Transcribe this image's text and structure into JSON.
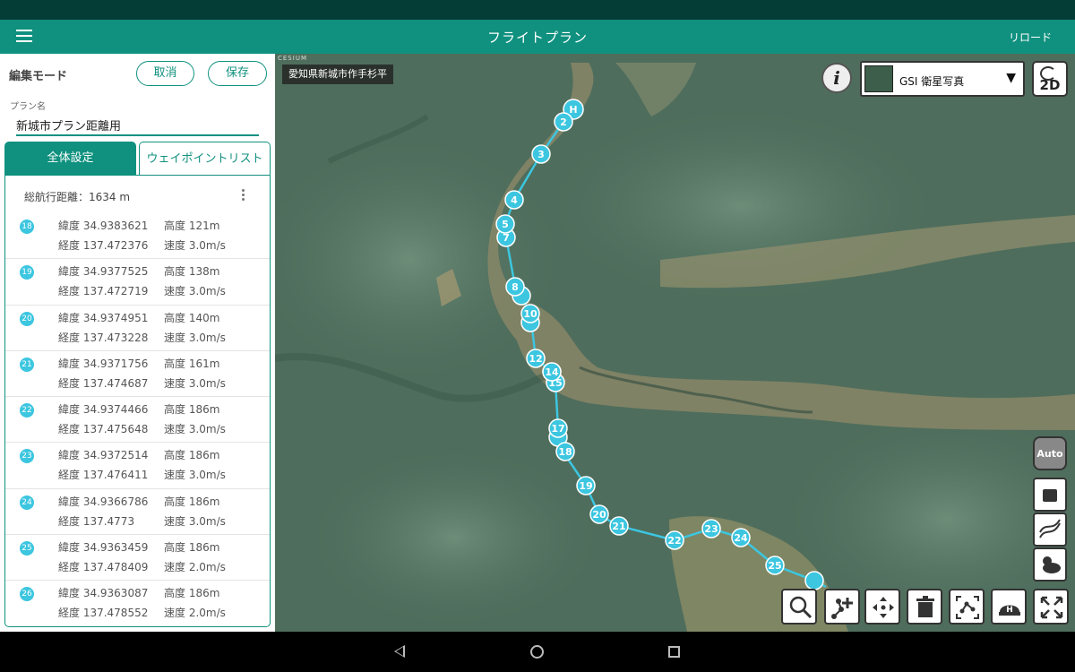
{
  "app_bar": {
    "title": "フライトプラン",
    "reload_label": "リロード"
  },
  "editor": {
    "mode_label": "編集モード",
    "cancel_label": "取消",
    "save_label": "保存",
    "plan_name_label": "プラン名",
    "plan_name_value": "新城市プラン距離用"
  },
  "tabs": {
    "global_label": "全体設定",
    "waypoints_label": "ウェイポイントリスト"
  },
  "waypoints": {
    "total_distance": "総航行距離：1634 m",
    "items": [
      {
        "num": "18",
        "lat": "緯度 34.9383621",
        "lon": "経度 137.472376",
        "alt": "高度 121m",
        "speed": "速度 3.0m/s"
      },
      {
        "num": "19",
        "lat": "緯度 34.9377525",
        "lon": "経度 137.472719",
        "alt": "高度 138m",
        "speed": "速度 3.0m/s"
      },
      {
        "num": "20",
        "lat": "緯度 34.9374951",
        "lon": "経度 137.473228",
        "alt": "高度 140m",
        "speed": "速度 3.0m/s"
      },
      {
        "num": "21",
        "lat": "緯度 34.9371756",
        "lon": "経度 137.474687",
        "alt": "高度 161m",
        "speed": "速度 3.0m/s"
      },
      {
        "num": "22",
        "lat": "緯度 34.9374466",
        "lon": "経度 137.475648",
        "alt": "高度 186m",
        "speed": "速度 3.0m/s"
      },
      {
        "num": "23",
        "lat": "緯度 34.9372514",
        "lon": "経度 137.476411",
        "alt": "高度 186m",
        "speed": "速度 3.0m/s"
      },
      {
        "num": "24",
        "lat": "緯度 34.9366786",
        "lon": "経度 137.4773",
        "alt": "高度 186m",
        "speed": "速度 3.0m/s"
      },
      {
        "num": "25",
        "lat": "緯度 34.9363459",
        "lon": "経度 137.478409",
        "alt": "高度 186m",
        "speed": "速度 2.0m/s"
      },
      {
        "num": "26",
        "lat": "緯度 34.9363087",
        "lon": "経度 137.478552",
        "alt": "高度 186m",
        "speed": "速度 2.0m/s"
      }
    ]
  },
  "map": {
    "attribution": "CESIUM",
    "location_label": "愛知県新城市作手杉平",
    "info_label": "i",
    "layer_select_value": "GSI 衛星写真",
    "layer_caret": "▼",
    "view_mode_label": "2D",
    "auto_label": "Auto",
    "home_marker_label": "H",
    "route_markers": [
      "2",
      "3",
      "4",
      "5",
      "7",
      "8",
      "10",
      "12",
      "13",
      "14",
      "15",
      "17",
      "18",
      "19",
      "20",
      "21",
      "22",
      "23",
      "24",
      "25"
    ],
    "route_color": "#3cc6e0",
    "icons": [
      "zoom-icon",
      "add-waypoint-icon",
      "move-icon",
      "trash-icon",
      "route-icon",
      "home-point-icon",
      "expand-icon",
      "camera-icon",
      "flight-path-icon",
      "weather-icon"
    ]
  },
  "colors": {
    "accent": "#10917f",
    "status_bar": "#043c36",
    "waypoint": "#3cc6e0"
  }
}
